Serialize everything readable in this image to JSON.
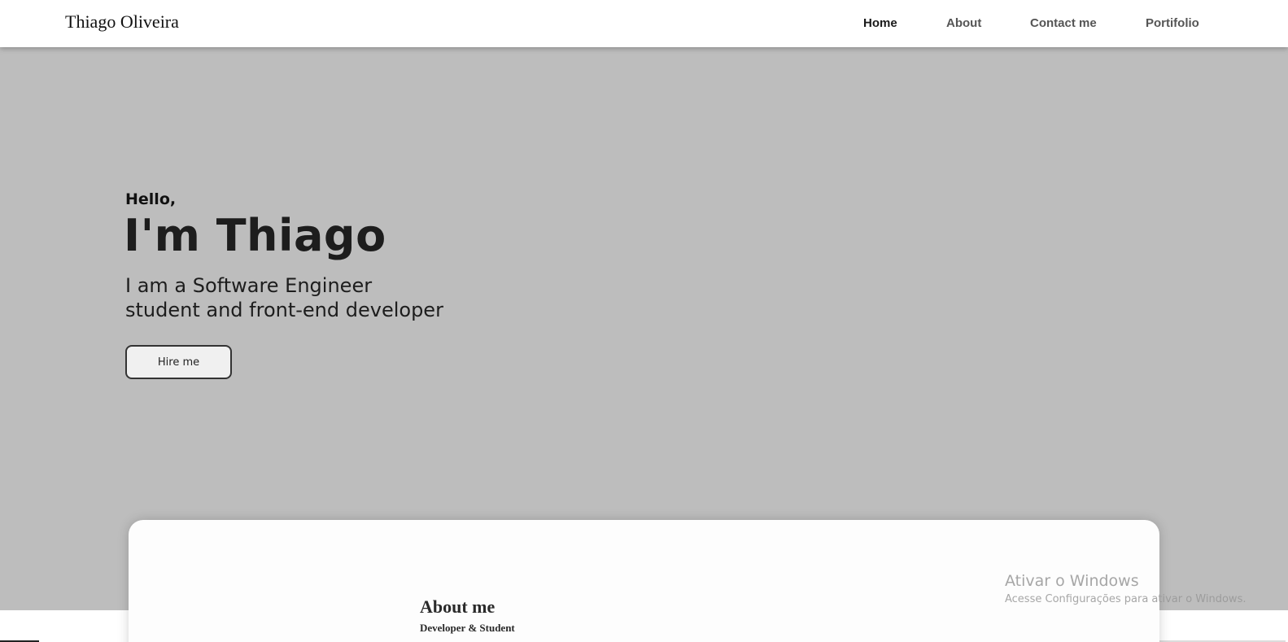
{
  "header": {
    "brand": "Thiago Oliveira",
    "nav": [
      {
        "label": "Home",
        "active": true
      },
      {
        "label": "About",
        "active": false
      },
      {
        "label": "Contact me",
        "active": false
      },
      {
        "label": "Portifolio",
        "active": false
      }
    ]
  },
  "hero": {
    "greeting": "Hello,",
    "name": "I'm Thiago",
    "description_line1": "I am a Software Engineer",
    "description_line2": "student and front-end developer",
    "cta_label": "Hire me"
  },
  "about": {
    "title": "About me",
    "subtitle": "Developer & Student"
  },
  "watermark": {
    "title": "Ativar o Windows",
    "subtitle": "Acesse Configurações para ativar o Windows."
  },
  "colors": {
    "hero_background": "#bdbdbd",
    "navbar_background": "#ffffff",
    "card_background": "#fdfdfd",
    "button_background": "#f0f0f0"
  }
}
